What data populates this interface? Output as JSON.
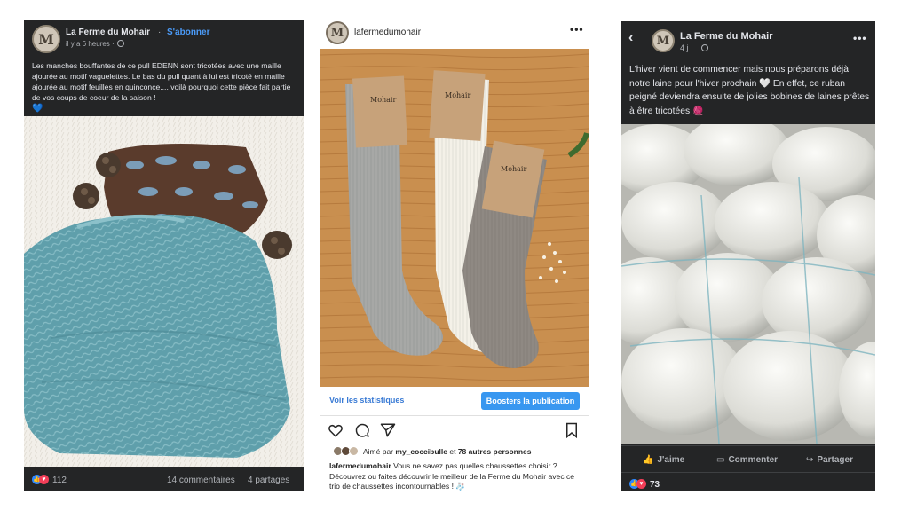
{
  "facebook_post_1": {
    "page_name": "La Ferme du Mohair",
    "separator": "·",
    "subscribe_label": "S'abonner",
    "timestamp": "il y a 6 heures ·",
    "post_text": "Les manches bouffantes de ce pull EDENN sont tricotées avec une maille ajourée au motif vaguelettes. Le bas du pull quant à lui est tricoté en maille ajourée au motif feuilles en quinconce.... voilà pourquoi cette pièce fait partie de vos coups de coeur de la saison !",
    "post_emoji": "💙",
    "reactions_count": "112",
    "comments_label": "14 commentaires",
    "shares_label": "4 partages",
    "image_icon": "globe-icon"
  },
  "instagram_post": {
    "username": "lafermedumohair",
    "more_icon": "more-icon",
    "stats_link": "Voir les statistiques",
    "boost_button": "Boosters la publication",
    "liked_by_prefix": "Aimé par",
    "liked_by_user": "my_coccibulle",
    "liked_by_connector": "et",
    "liked_by_others": "78 autres personnes",
    "caption_user": "lafermedumohair",
    "caption_text": "Vous ne savez pas quelles chaussettes choisir ? Découvrez ou faites découvrir le meilleur de la Ferme du Mohair avec ce trio de chaussettes incontournables ! 🧦",
    "product_label": "Mohair"
  },
  "facebook_post_2": {
    "back_icon": "back-arrow-icon",
    "page_name": "La Ferme du Mohair",
    "timestamp": "4 j ·",
    "post_text": "L'hiver vient de commencer mais nous préparons déjà notre laine pour l'hiver prochain 🤍 En effet, ce ruban peigné deviendra ensuite de jolies bobines de laines prêtes à être tricotées 🧶",
    "like_label": "J'aime",
    "comment_label": "Commenter",
    "share_label": "Partager",
    "reactions_count": "73"
  },
  "avatar_letter": "M",
  "colors": {
    "fb_dark_bg": "#242526",
    "fb_link_blue": "#4b9bf8",
    "ig_boost_blue": "#3897f0",
    "knit_teal": "#5a9aa6"
  }
}
